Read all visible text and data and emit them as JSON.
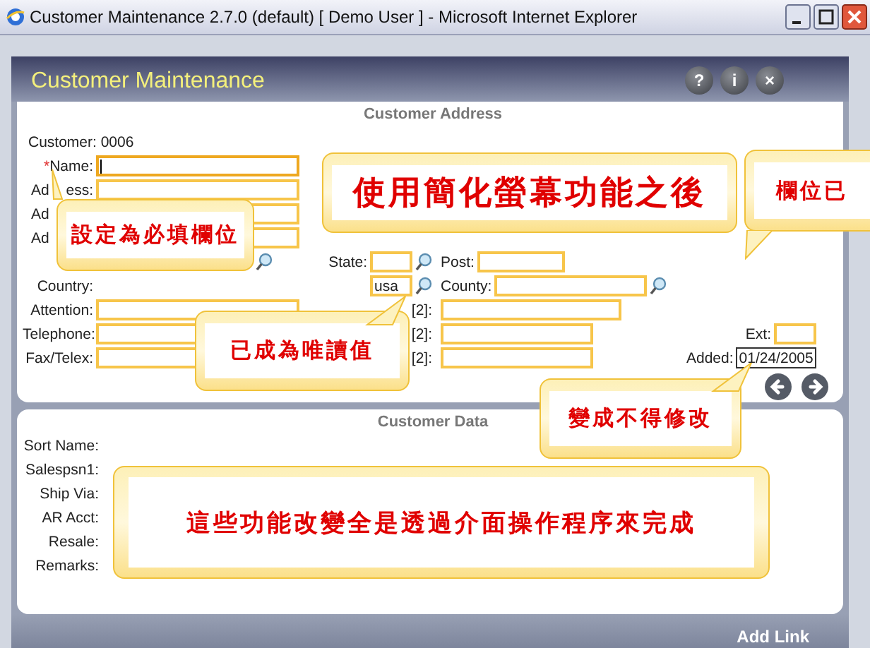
{
  "window": {
    "title": "Customer Maintenance 2.7.0 (default) [ Demo User ] - Microsoft Internet Explorer"
  },
  "app": {
    "title": "Customer Maintenance",
    "header_buttons": [
      {
        "label": "?"
      },
      {
        "label": "i"
      },
      {
        "label": "×"
      }
    ]
  },
  "address_section": {
    "heading": "Customer Address",
    "customer": "Customer: 0006",
    "rows": [
      {
        "left": [
          {
            "kind": "label",
            "text": "Name:",
            "required_mark": "*"
          },
          {
            "kind": "wideinput",
            "focused": true,
            "readonly": false
          }
        ]
      },
      {
        "left": [
          {
            "kind": "cutlabel",
            "text": "Ad"
          },
          {
            "kind": "label",
            "text": "ess:"
          },
          {
            "kind": "wideinput",
            "focused": false,
            "readonly": false
          }
        ]
      },
      {
        "left": [
          {
            "kind": "cutlabel",
            "text": "Ad"
          },
          {
            "kind": "wideinput",
            "focused": false,
            "readonly": false
          }
        ]
      },
      {
        "left": [
          {
            "kind": "cutlabel",
            "text": "Ad"
          },
          {
            "kind": "wideinput",
            "focused": false,
            "readonly": false
          }
        ]
      },
      {
        "left": [
          {
            "kind": "lookup"
          }
        ],
        "mid": [
          {
            "kind": "label",
            "text": "State:"
          },
          {
            "kind": "tinyinput",
            "focused": false,
            "readonly": false
          },
          {
            "kind": "lookup"
          }
        ],
        "mid2": [
          {
            "kind": "label",
            "text": "Post:"
          },
          {
            "kind": "shortinput",
            "focused": false,
            "readonly": false
          }
        ]
      },
      {
        "left": [
          {
            "kind": "label",
            "text": "Country:"
          }
        ],
        "mid": [
          {
            "kind": "tinyinput",
            "value": "usa",
            "focused": false,
            "readonly": false
          },
          {
            "kind": "lookup"
          }
        ],
        "mid2": [
          {
            "kind": "label",
            "text": "County:"
          },
          {
            "kind": "input",
            "focused": false,
            "readonly": false
          },
          {
            "kind": "lookup"
          }
        ]
      },
      {
        "left": [
          {
            "kind": "label",
            "text": "Attention:"
          },
          {
            "kind": "wideinput",
            "focused": false,
            "readonly": false
          }
        ],
        "mid": [
          {
            "kind": "label",
            "text": "[2]:"
          }
        ],
        "mid2": [
          {
            "kind": "wideinput",
            "focused": false,
            "readonly": false
          }
        ]
      },
      {
        "left": [
          {
            "kind": "label",
            "text": "Telephone:"
          },
          {
            "kind": "wideinput",
            "focused": false,
            "readonly": false
          }
        ],
        "mid": [
          {
            "kind": "label",
            "text": "[2]:"
          }
        ],
        "mid2": [
          {
            "kind": "input",
            "focused": false,
            "readonly": false
          }
        ],
        "right": [
          {
            "kind": "label",
            "text": "Ext:"
          },
          {
            "kind": "tinyinput",
            "focused": false,
            "readonly": false
          }
        ]
      },
      {
        "left": [
          {
            "kind": "label",
            "text": "Fax/Telex:"
          },
          {
            "kind": "wideinput",
            "focused": false,
            "readonly": false
          }
        ],
        "mid": [
          {
            "kind": "label",
            "text": "[2]:"
          }
        ],
        "mid2": [
          {
            "kind": "input",
            "focused": false,
            "readonly": false
          }
        ],
        "right": [
          {
            "kind": "label",
            "text": "Added:"
          },
          {
            "kind": "shortinput",
            "value": "01/24/2005",
            "focused": false,
            "readonly": true
          }
        ]
      }
    ],
    "nav_buttons": [
      {
        "kind": "back"
      },
      {
        "kind": "forward"
      }
    ]
  },
  "data_section": {
    "heading": "Customer Data",
    "labels": [
      "Sort Name:",
      "Salespsn1:",
      "Ship Via:",
      "AR Acct:",
      "Resale:",
      "Remarks:"
    ]
  },
  "footer": {
    "link": "Add Link"
  },
  "callouts": [
    {
      "text": "使用簡化螢幕功能之後",
      "kind": "plain"
    },
    {
      "text": "欄位已",
      "kind": "downleft"
    },
    {
      "text": "設定為必填欄位",
      "kind": "upleft"
    },
    {
      "text": "已成為唯讀值",
      "kind": "upright"
    },
    {
      "text": "變成不得修改",
      "kind": "upright"
    },
    {
      "text": "這些功能改變全是透過介面操作程序來完成",
      "kind": "plain"
    }
  ]
}
